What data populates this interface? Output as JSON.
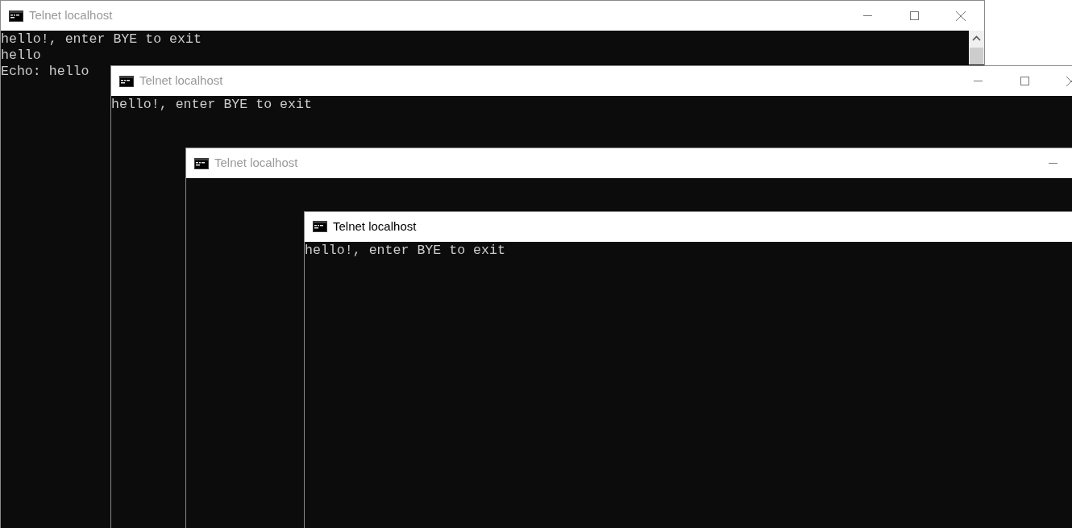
{
  "windows": [
    {
      "title": "Telnet localhost",
      "active": false,
      "scrollbar": true,
      "lines": [
        "hello!, enter BYE to exit",
        "hello",
        "Echo: hello"
      ],
      "controls": [
        {
          "kind": "minimize"
        },
        {
          "kind": "maximize"
        },
        {
          "kind": "close"
        }
      ]
    },
    {
      "title": "Telnet localhost",
      "active": false,
      "lines": [
        "hello!, enter BYE to exit"
      ],
      "controls": [
        {
          "kind": "minimize"
        },
        {
          "kind": "maximize"
        },
        {
          "kind": "close"
        }
      ]
    },
    {
      "title": "Telnet localhost",
      "active": false,
      "controls": [
        {
          "kind": "minimize"
        }
      ]
    },
    {
      "title": "Telnet localhost",
      "active": true,
      "lines": [
        "hello!, enter BYE to exit"
      ]
    }
  ]
}
